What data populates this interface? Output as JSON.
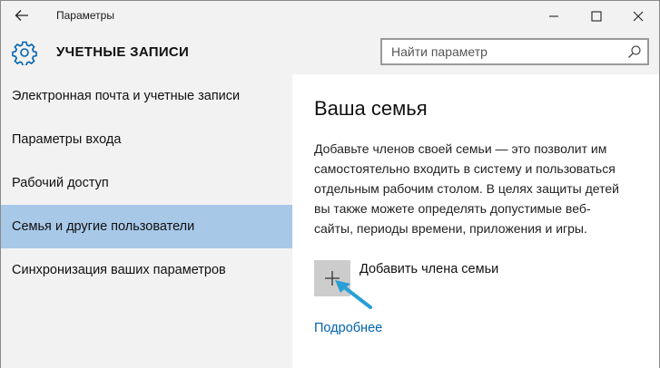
{
  "titlebar": {
    "title": "Параметры",
    "back_icon": "arrow-left-icon",
    "minimize_icon": "minimize-icon",
    "maximize_icon": "maximize-icon",
    "close_icon": "close-icon"
  },
  "header": {
    "icon": "gear-icon",
    "title": "УЧЕТНЫЕ ЗАПИСИ",
    "search": {
      "placeholder": "Найти параметр",
      "value": "",
      "icon": "search-icon"
    }
  },
  "sidebar": {
    "items": [
      {
        "label": "Электронная почта и учетные записи",
        "selected": false
      },
      {
        "label": "Параметры входа",
        "selected": false
      },
      {
        "label": "Рабочий доступ",
        "selected": false
      },
      {
        "label": "Семья и другие пользователи",
        "selected": true
      },
      {
        "label": "Синхронизация ваших параметров",
        "selected": false
      }
    ]
  },
  "main": {
    "title": "Ваша семья",
    "description_lines": [
      "Добавьте членов своей семьи — это позволит им",
      "самостоятельно входить в систему и пользоваться",
      "отдельным рабочим столом. В целях защиты детей",
      "вы также можете определять допустимые веб-",
      "сайты, периоды времени, приложения и игры."
    ],
    "add_button_icon": "plus-icon",
    "add_label": "Добавить члена семьи",
    "more_link": "Подробнее",
    "annotation_icon": "pointer-arrow-icon"
  },
  "colors": {
    "selected_bg": "#a8c8e8",
    "sidebar_bg": "#f2f2f2",
    "accent": "#0063b1",
    "annotation_arrow": "#2a9fd6",
    "gear": "#0063b1"
  }
}
